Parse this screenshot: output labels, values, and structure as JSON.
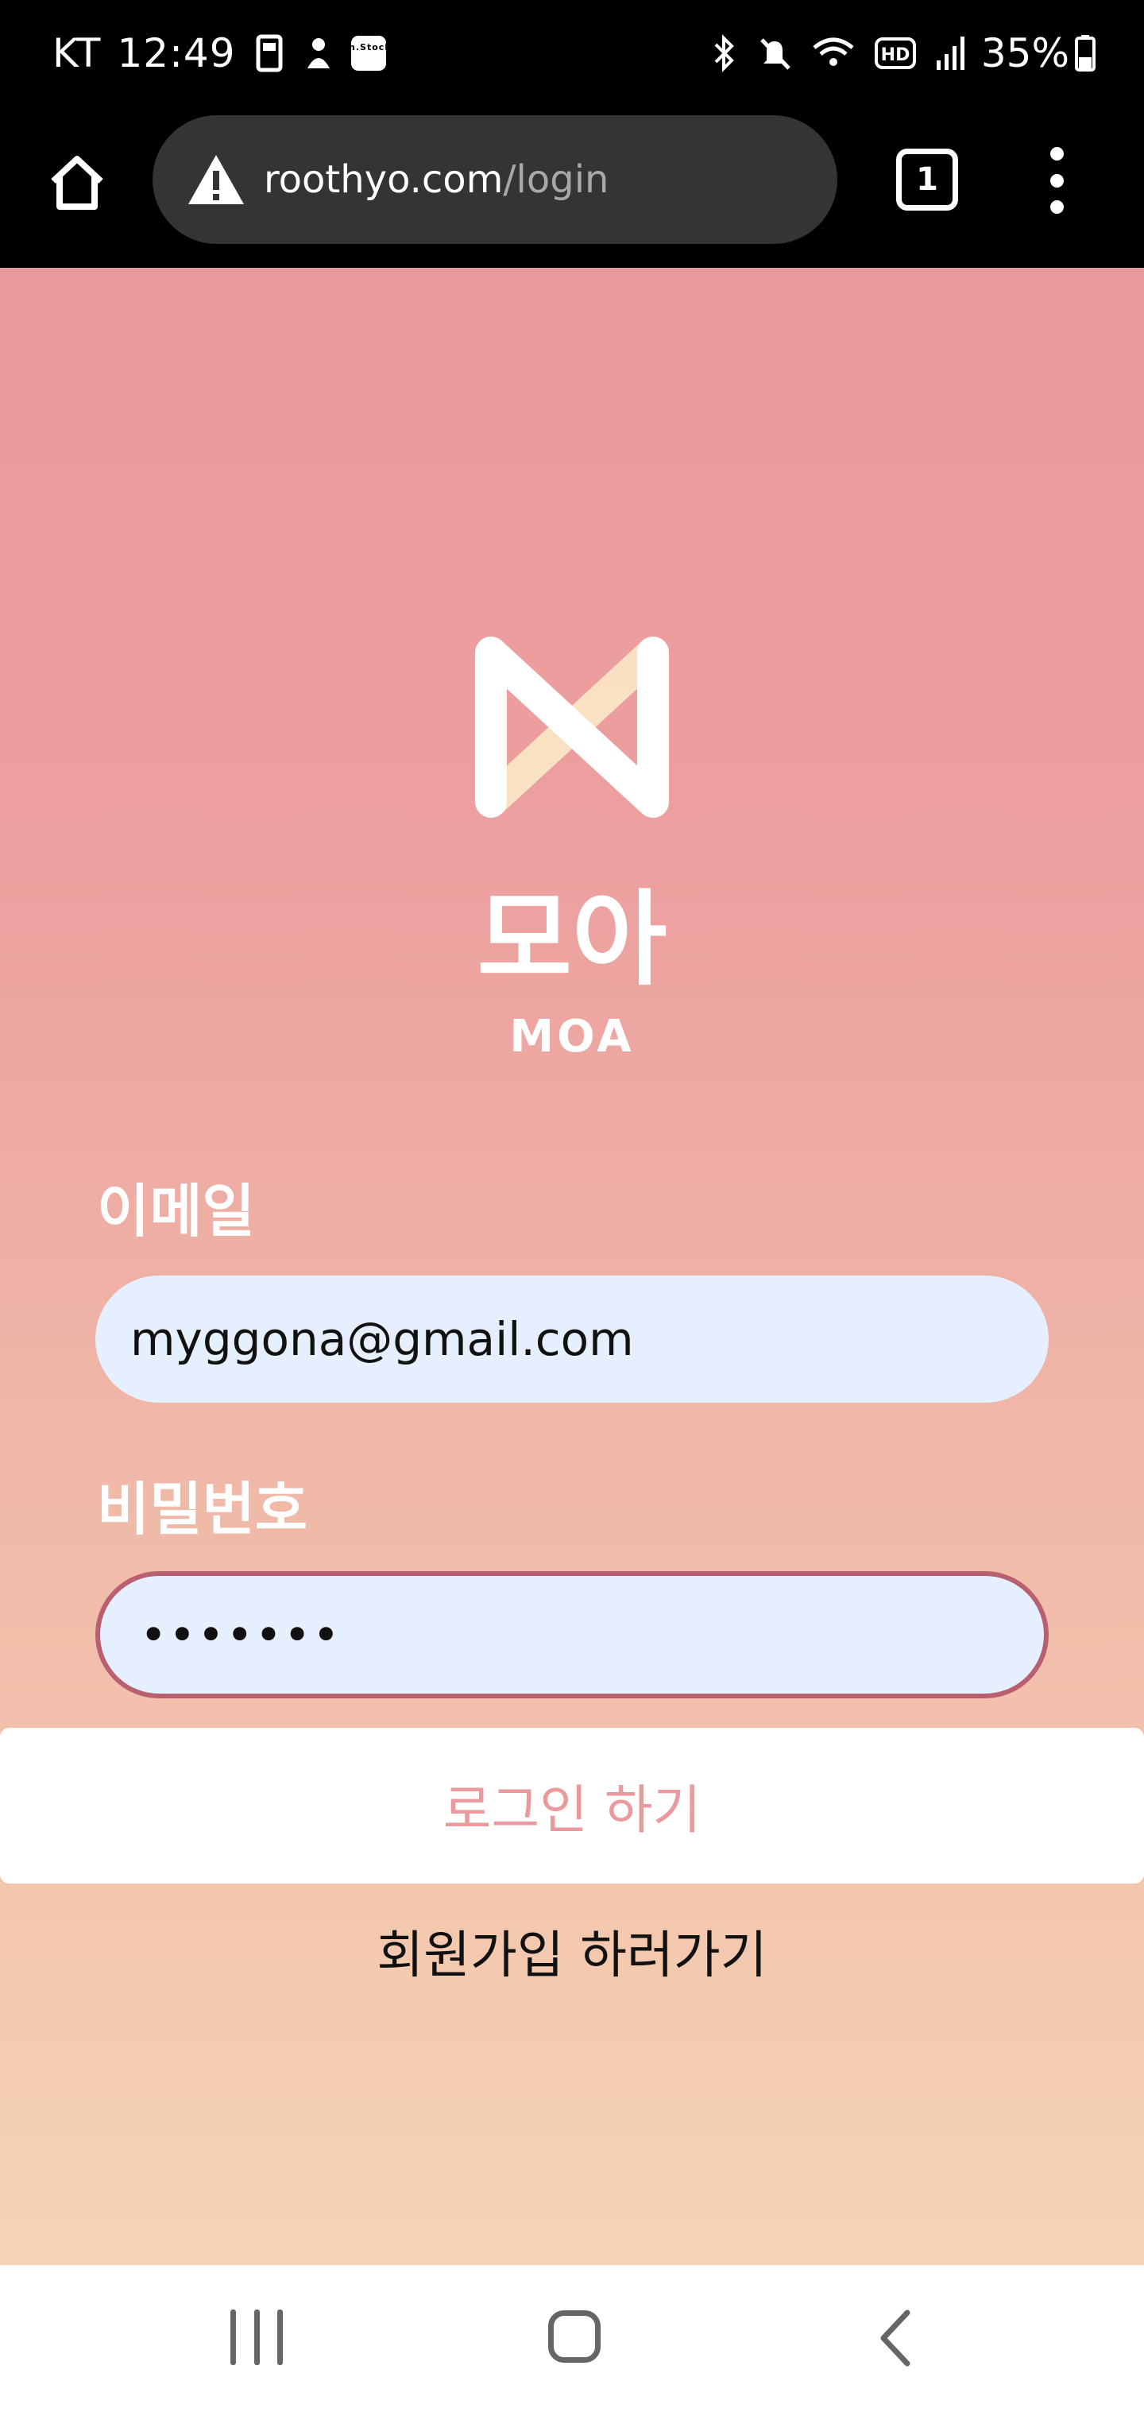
{
  "status_bar": {
    "carrier": "KT",
    "time": "12:49",
    "battery_percent": "35%",
    "left_icons": [
      "sim-icon",
      "notification-icon",
      "stock-app-icon"
    ],
    "right_icons": [
      "bluetooth-icon",
      "mute-icon",
      "wifi-icon",
      "hd-icon",
      "signal-icon",
      "battery-icon"
    ],
    "stock_app_label": "m.Stock",
    "hd_label": "HD"
  },
  "browser": {
    "url_domain": "roothyo.com",
    "url_path": "/login",
    "tab_count": "1"
  },
  "app": {
    "logo_text": "모아",
    "logo_subtext": "MOA"
  },
  "form": {
    "email_label": "이메일",
    "email_value": "myggona@gmail.com",
    "password_label": "비밀번호",
    "password_value": "•••••••",
    "login_button": "로그인 하기",
    "signup_link": "회원가입 하러가기"
  },
  "colors": {
    "brand_pink": "#eb989b",
    "input_bg": "#e6effd",
    "focus_border": "#b86070"
  }
}
